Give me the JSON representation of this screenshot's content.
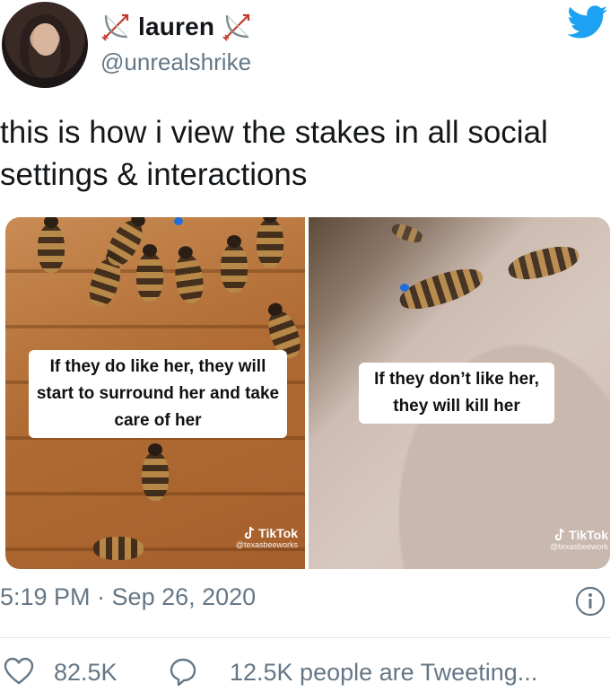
{
  "user": {
    "name": "lauren",
    "handle": "@unrealshrike"
  },
  "tweet": {
    "text": "this is how i view the stakes in all social settings & interactions"
  },
  "media": {
    "left_caption": "If they do like her, they will start to surround her and take care of her",
    "right_caption": "If they don’t like her, they will kill her",
    "left_watermark_brand": "TikTok",
    "left_watermark_user": "@texasbeeworks",
    "right_watermark_brand": "TikTok",
    "right_watermark_user": "@texasbeework"
  },
  "meta": {
    "timestamp": "5:19 PM · Sep 26, 2020"
  },
  "actions": {
    "likes": "82.5K",
    "tweeting": "12.5K people are Tweeting..."
  },
  "colors": {
    "twitter_blue": "#1da1f2",
    "secondary_text": "#657786",
    "queen_marker": "#1e6fd9"
  },
  "icons": [
    "bow-and-arrow-icon",
    "twitter-bird-icon",
    "info-icon",
    "heart-icon",
    "comment-bubble-icon",
    "tiktok-icon"
  ]
}
